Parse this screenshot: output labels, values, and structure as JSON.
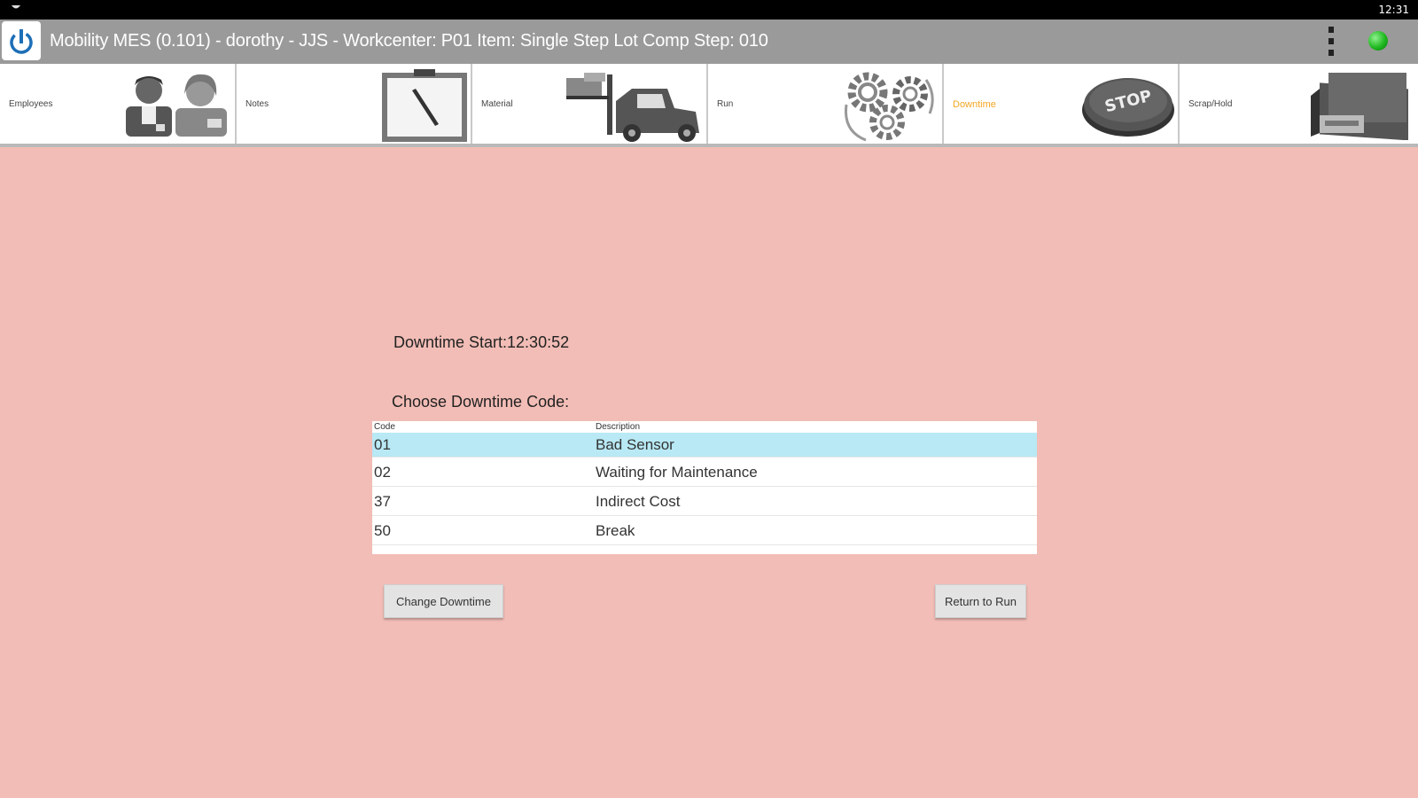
{
  "status_bar": {
    "clock": "12:31"
  },
  "title_bar": {
    "title": "Mobility MES (0.101) - dorothy - JJS - Workcenter: P01 Item: Single Step Lot Comp Step: 010"
  },
  "nav": {
    "items": [
      {
        "label": "Employees",
        "icon": "employees-icon"
      },
      {
        "label": "Notes",
        "icon": "clipboard-icon"
      },
      {
        "label": "Material",
        "icon": "forklift-icon"
      },
      {
        "label": "Run",
        "icon": "gears-icon"
      },
      {
        "label": "Downtime",
        "icon": "stop-button-icon",
        "active": true
      },
      {
        "label": "Scrap/Hold",
        "icon": "scrap-hold-icon"
      }
    ],
    "active_color": "#f5a623"
  },
  "main": {
    "downtime_start": "Downtime Start:12:30:52",
    "choose_label": "Choose Downtime Code:",
    "table": {
      "headers": [
        "Code",
        "Description"
      ],
      "rows": [
        {
          "code": "01",
          "description": "Bad Sensor",
          "selected": true
        },
        {
          "code": "02",
          "description": "Waiting for Maintenance"
        },
        {
          "code": "37",
          "description": "Indirect Cost"
        },
        {
          "code": "50",
          "description": "Break"
        }
      ]
    },
    "buttons": {
      "change": "Change Downtime",
      "return": "Return to Run"
    }
  },
  "colors": {
    "background": "#f2bdb6",
    "title_bar": "#9a9a9a",
    "selected_row": "#b8e9f4",
    "connection_status": "#1fb81f"
  }
}
